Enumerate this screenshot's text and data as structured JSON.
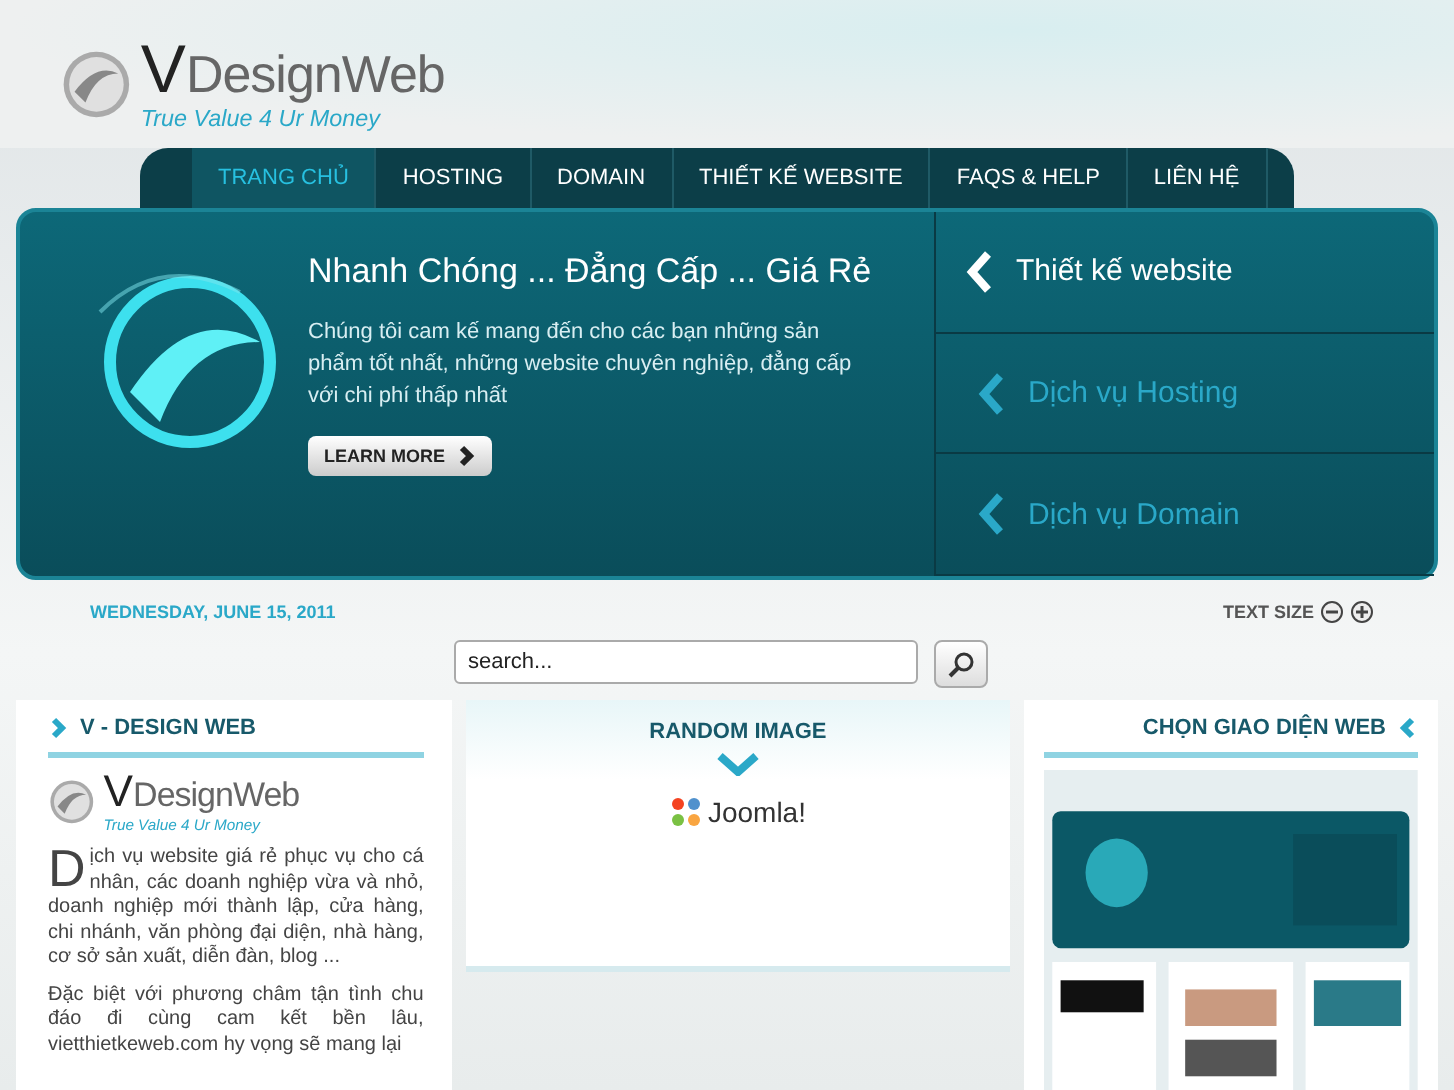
{
  "header": {
    "logo": {
      "mark": "V",
      "name": "DesignWeb",
      "tagline": "True Value 4 Ur Money"
    }
  },
  "nav": [
    {
      "label": "TRANG CHỦ",
      "selected": true
    },
    {
      "label": "HOSTING",
      "selected": false
    },
    {
      "label": "DOMAIN",
      "selected": false
    },
    {
      "label": "THIẾT KẾ WEBSITE",
      "selected": false
    },
    {
      "label": "FAQS & HELP",
      "selected": false
    },
    {
      "label": "LIÊN HỆ",
      "selected": false
    }
  ],
  "hero": {
    "title": "Nhanh Chóng ... Đẳng Cấp ... Giá Rẻ",
    "text": "Chúng tôi cam kế mang đến cho các bạn những sản phẩm tốt nhất, những website chuyên nghiệp, đẳng cấp với chi phí thấp nhất",
    "button": "LEARN MORE",
    "menu": [
      {
        "label": "Thiết kế website",
        "selected": true
      },
      {
        "label": "Dịch vụ Hosting",
        "selected": false
      },
      {
        "label": "Dịch vụ Domain",
        "selected": false
      }
    ]
  },
  "date": "WEDNESDAY, JUNE 15, 2011",
  "text_size": "TEXT SIZE",
  "search": {
    "placeholder": "search..."
  },
  "left": {
    "title": "V - DESIGN WEB",
    "logo": {
      "mark": "V",
      "name": "DesignWeb",
      "tagline": "True Value 4 Ur Money"
    },
    "paragraphs": [
      "Dịch vụ website giá rẻ phục vụ cho cá nhân, các doanh nghiệp vừa và nhỏ, doanh nghiệp mới thành lập, cửa hàng, chi nhánh, văn phòng đại diện, nhà hàng, cơ sở sản xuất, diễn đàn, blog ...",
      "Đặc biệt với phương châm tận tình chu đáo đi cùng cam kết bền lâu, vietthietkeweb.com hy vọng sẽ mang lại"
    ]
  },
  "center": {
    "title": "RANDOM IMAGE",
    "logo": "Joomla!"
  },
  "right": {
    "title": "CHỌN GIAO DIỆN WEB"
  }
}
